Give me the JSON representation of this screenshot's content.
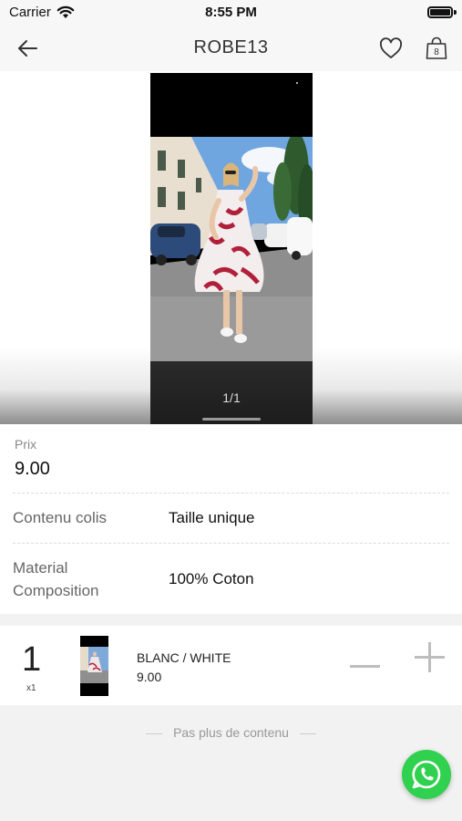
{
  "status_bar": {
    "carrier": "Carrier",
    "time": "8:55 PM"
  },
  "nav": {
    "title": "ROBE13",
    "cart_count": "8"
  },
  "gallery": {
    "counter": "1/1"
  },
  "details": {
    "price_label": "Prix",
    "price_value": "9.00",
    "rows": [
      {
        "label": "Contenu colis",
        "value": "Taille unique"
      },
      {
        "label_line1": "Material",
        "label_line2": "Composition",
        "value": "100% Coton"
      }
    ]
  },
  "variant": {
    "quantity": "1",
    "quantity_note": "x1",
    "name": "BLANC / WHITE",
    "price": "9.00"
  },
  "footer": {
    "no_more_text": "Pas plus de contenu"
  },
  "colors": {
    "whatsapp": "#2fd14e",
    "divider": "#dcdcdc",
    "muted_text": "#888888"
  },
  "icons": [
    "back-arrow-icon",
    "heart-icon",
    "shopping-bag-icon",
    "minus-icon",
    "plus-icon",
    "whatsapp-icon",
    "wifi-icon",
    "battery-icon"
  ]
}
